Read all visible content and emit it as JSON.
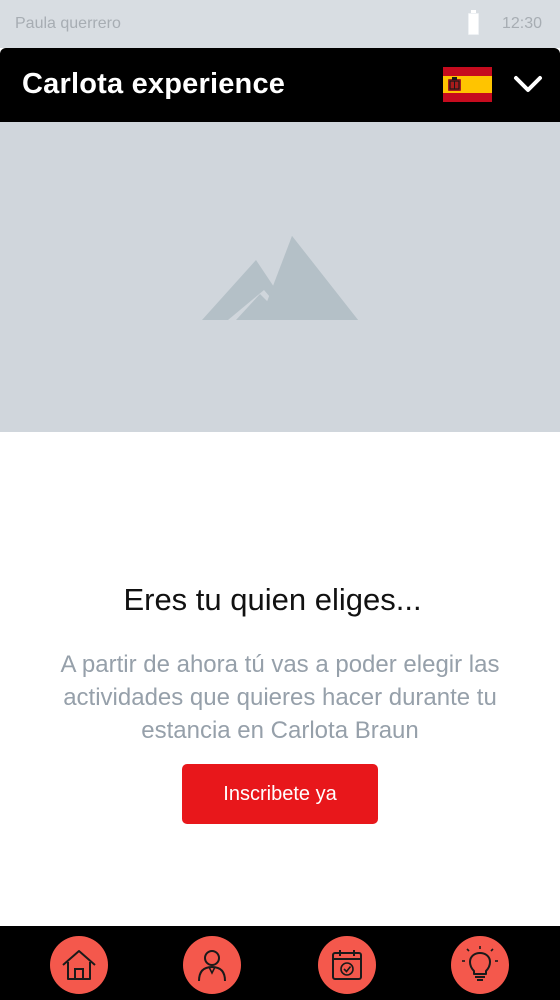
{
  "status_bar": {
    "carrier": "Paula querrero",
    "time": "12:30",
    "icons": [
      "battery-icon"
    ]
  },
  "header": {
    "title": "Carlota experience",
    "language_flag": "spain-flag-icon",
    "menu_icon": "chevron-down-icon"
  },
  "hero": {
    "icon": "image-placeholder-icon"
  },
  "content": {
    "headline": "Eres tu quien eliges...",
    "description": "A partir de ahora tú vas a poder elegir las actividades que quieres hacer durante tu estancia en Carlota Braun",
    "cta_label": "Inscribete ya"
  },
  "bottom_nav": {
    "items": [
      {
        "icon": "home-icon"
      },
      {
        "icon": "user-icon"
      },
      {
        "icon": "calendar-check-icon"
      },
      {
        "icon": "lightbulb-icon"
      }
    ]
  },
  "colors": {
    "accent": "#e8171b",
    "nav_button": "#f4584c",
    "header_bg": "#000000",
    "hero_bg": "#d0d6dc",
    "placeholder_icon": "#b4c0c7",
    "text_muted": "#96a0aa"
  }
}
